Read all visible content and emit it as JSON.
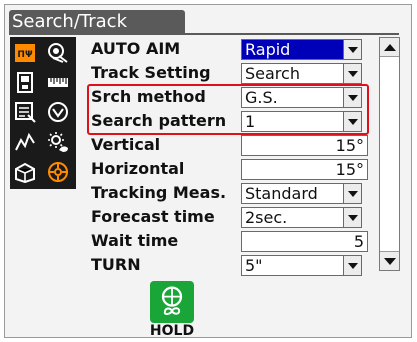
{
  "window": {
    "title": "Search/Track"
  },
  "settings": {
    "auto_aim": {
      "label": "AUTO AIM",
      "value": "Rapid"
    },
    "track_setting": {
      "label": "Track Setting",
      "value": "Search"
    },
    "srch_method": {
      "label": "Srch method",
      "value": "G.S."
    },
    "search_pattern": {
      "label": "Search pattern",
      "value": "1"
    },
    "vertical": {
      "label": "Vertical",
      "value": "15°"
    },
    "horizontal": {
      "label": "Horizontal",
      "value": "15°"
    },
    "tracking_meas": {
      "label": "Tracking Meas.",
      "value": "Standard"
    },
    "forecast_time": {
      "label": "Forecast time",
      "value": "2sec."
    },
    "wait_time": {
      "label": "Wait time",
      "value": "5"
    },
    "turn": {
      "label": "TURN",
      "value": "5\""
    }
  },
  "hold_button": {
    "label": "HOLD"
  },
  "colors": {
    "selected_bg": "#0000b8",
    "highlight_border": "#e0101a",
    "hold_bg": "#1aa538",
    "icon_orange": "#ff8a00"
  },
  "icons": [
    "measure-mode-icon",
    "prism-target-icon",
    "data-card-icon",
    "ruler-icon",
    "document-icon",
    "tilt-icon",
    "graph-icon",
    "sun-icon",
    "box-icon",
    "target-search-icon"
  ]
}
